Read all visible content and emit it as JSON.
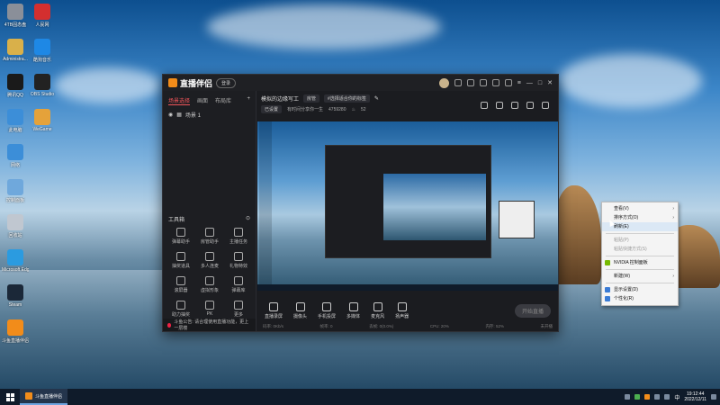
{
  "desktop": {
    "icons": [
      {
        "label": "4TB固态盘",
        "color": "#8a8f99"
      },
      {
        "label": "Administra...",
        "color": "#d9b04a"
      },
      {
        "label": "腾讯QQ",
        "color": "#1a1a1a"
      },
      {
        "label": "此电脑",
        "color": "#3c8ed8"
      },
      {
        "label": "网络",
        "color": "#3c8ed8"
      },
      {
        "label": "控制面板",
        "color": "#6fa8dc"
      },
      {
        "label": "回收站",
        "color": "#c0c7d0"
      },
      {
        "label": "Microsoft Edge",
        "color": "#2b9be0"
      },
      {
        "label": "Steam",
        "color": "#1b2838"
      },
      {
        "label": "斗鱼直播伴侣",
        "color": "#f28c1a"
      }
    ],
    "icons_col2": [
      {
        "label": "人民网",
        "color": "#d32f2f"
      },
      {
        "label": "酷狗音乐",
        "color": "#1e88e5"
      },
      {
        "label": "OBS Studio",
        "color": "#222"
      },
      {
        "label": "WeGame",
        "color": "#e5a23a"
      }
    ]
  },
  "app": {
    "name": "直播伴侣",
    "title_pill": "登录",
    "left_tabs": [
      "场景选择",
      "画面",
      "布局库"
    ],
    "scene_label": "场景 1",
    "tools_title": "工具箱",
    "tools": [
      "弹幕助手",
      "房管助手",
      "主播任务",
      "抽奖道具",
      "多人连麦",
      "礼物特效",
      "滚屏器",
      "虚拟形象",
      "弹幕库",
      "助力抽奖",
      "PK",
      "更多"
    ],
    "notice": "斗鱼公告: 请合理使用直播功能，更上一层楼",
    "room_title": "模拟的边缘写工",
    "room_chips": [
      "房管",
      "#选择适合你的标签"
    ],
    "room_row2": [
      "已设置",
      "有时间分享你一生",
      "4759280",
      "52"
    ],
    "bottom_buttons": [
      "直播录屏",
      "摄像头",
      "手机投屏",
      "多媒体",
      "麦克风",
      "扬声器"
    ],
    "start_button": "开始直播",
    "stats": [
      "码率: 0Kb/s",
      "帧率: 0",
      "丢帧: 0(0.0%)",
      "CPU: 20%",
      "内存: 52%",
      "未开播"
    ]
  },
  "context_menu": {
    "items": [
      {
        "label": "查看(V)",
        "submenu": true,
        "disabled": false
      },
      {
        "label": "排序方式(O)",
        "submenu": true,
        "disabled": false
      },
      {
        "label": "刷新(E)",
        "submenu": false,
        "disabled": false,
        "hover": true
      },
      {
        "sep": true
      },
      {
        "label": "粘贴(P)",
        "submenu": false,
        "disabled": true
      },
      {
        "label": "粘贴快捷方式(S)",
        "submenu": false,
        "disabled": true
      },
      {
        "sep": true
      },
      {
        "label": "NVIDIA 控制面板",
        "submenu": false,
        "disabled": false,
        "icon_color": "#76b900"
      },
      {
        "sep": true
      },
      {
        "label": "新建(W)",
        "submenu": true,
        "disabled": false
      },
      {
        "sep": true
      },
      {
        "label": "显示设置(D)",
        "submenu": false,
        "disabled": false,
        "icon_color": "#3a7bd5"
      },
      {
        "label": "个性化(R)",
        "submenu": false,
        "disabled": false,
        "icon_color": "#3a7bd5"
      }
    ]
  },
  "taskbar": {
    "app_label": "斗鱼直播伴侣",
    "time": "19:12:44",
    "date": "2022/12/11"
  }
}
